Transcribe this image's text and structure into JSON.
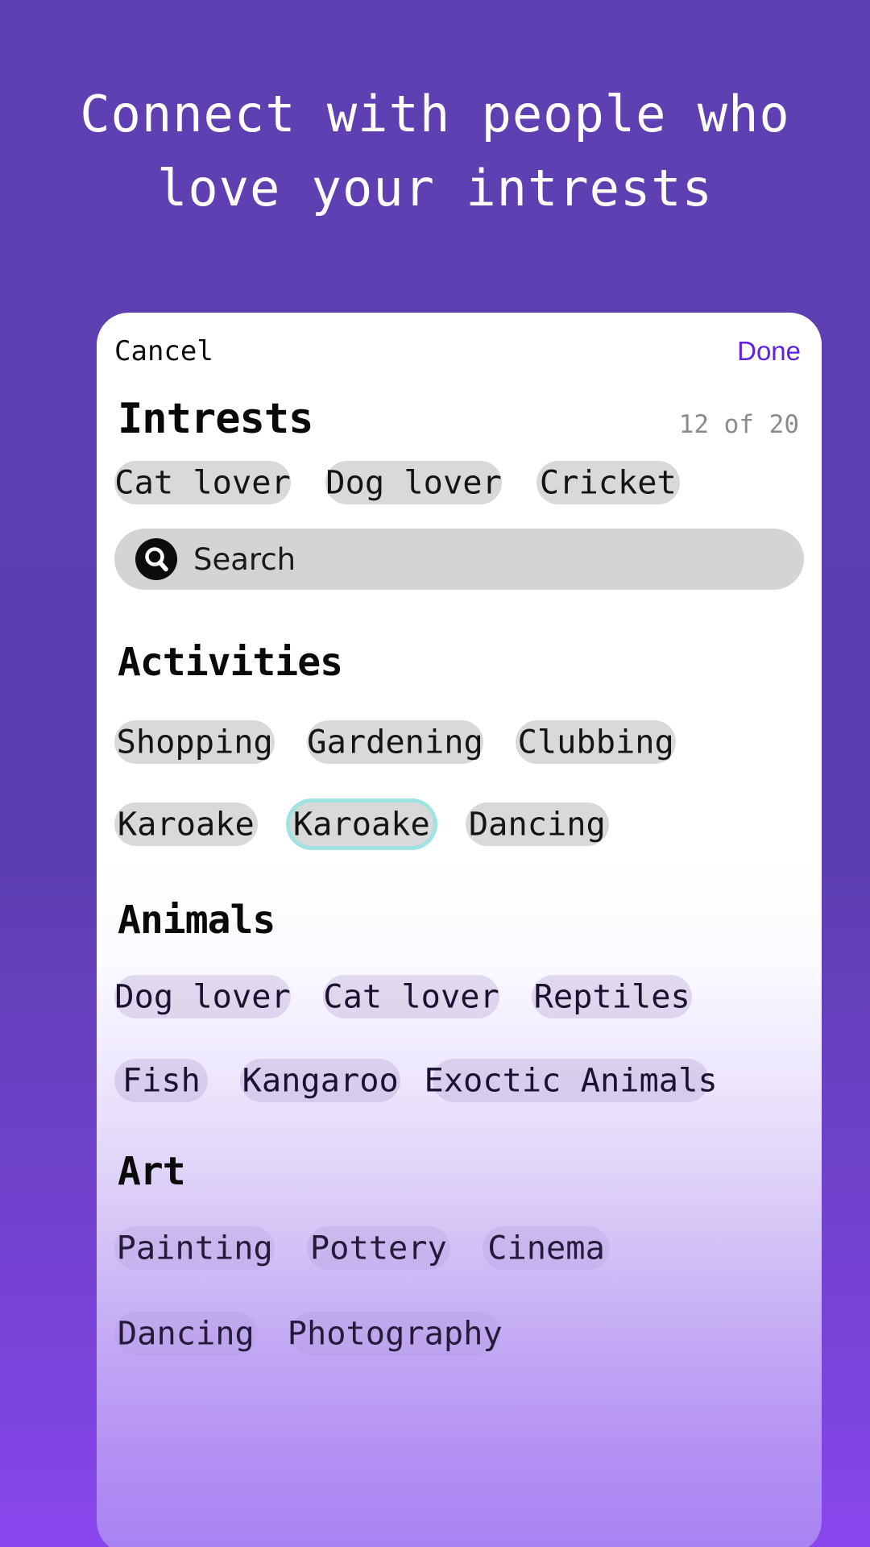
{
  "headline": {
    "line1": "Connect with people who",
    "line2": "love your intrests"
  },
  "sheet": {
    "cancel_label": "Cancel",
    "done_label": "Done",
    "title": "Intrests",
    "counter": "12 of 20",
    "selected_chips": [
      "Cat lover",
      "Dog lover",
      "Cricket"
    ],
    "search": {
      "placeholder": "Search",
      "value": "",
      "icon": "search-icon"
    },
    "groups": [
      {
        "name": "Activities",
        "rows": [
          [
            "Shopping",
            "Gardening",
            "Clubbing"
          ],
          [
            "Karoake",
            "Karoake",
            "Dancing"
          ]
        ],
        "focused": {
          "row": 1,
          "index": 1
        }
      },
      {
        "name": "Animals",
        "rows": [
          [
            "Dog lover",
            "Cat lover",
            "Reptiles"
          ],
          [
            "Fish",
            "Kangaroo",
            "Exoctic Animals"
          ]
        ],
        "focused": null
      },
      {
        "name": "Art",
        "rows": [
          [
            "Painting",
            "Pottery",
            "Cinema"
          ],
          [
            "Dancing",
            "Photography"
          ]
        ],
        "focused": null
      }
    ]
  },
  "colors": {
    "background_purple": "#5C3EB0",
    "background_purple_bottom": "#8A47EE",
    "sheet_white": "#FFFFFF",
    "done_accent": "#6020E0",
    "chip_grey": "#D9D9D9",
    "search_grey": "#D4D4D4",
    "counter_grey": "#8C8C8C",
    "focus_ring_cyan": "#9FE3E2"
  }
}
